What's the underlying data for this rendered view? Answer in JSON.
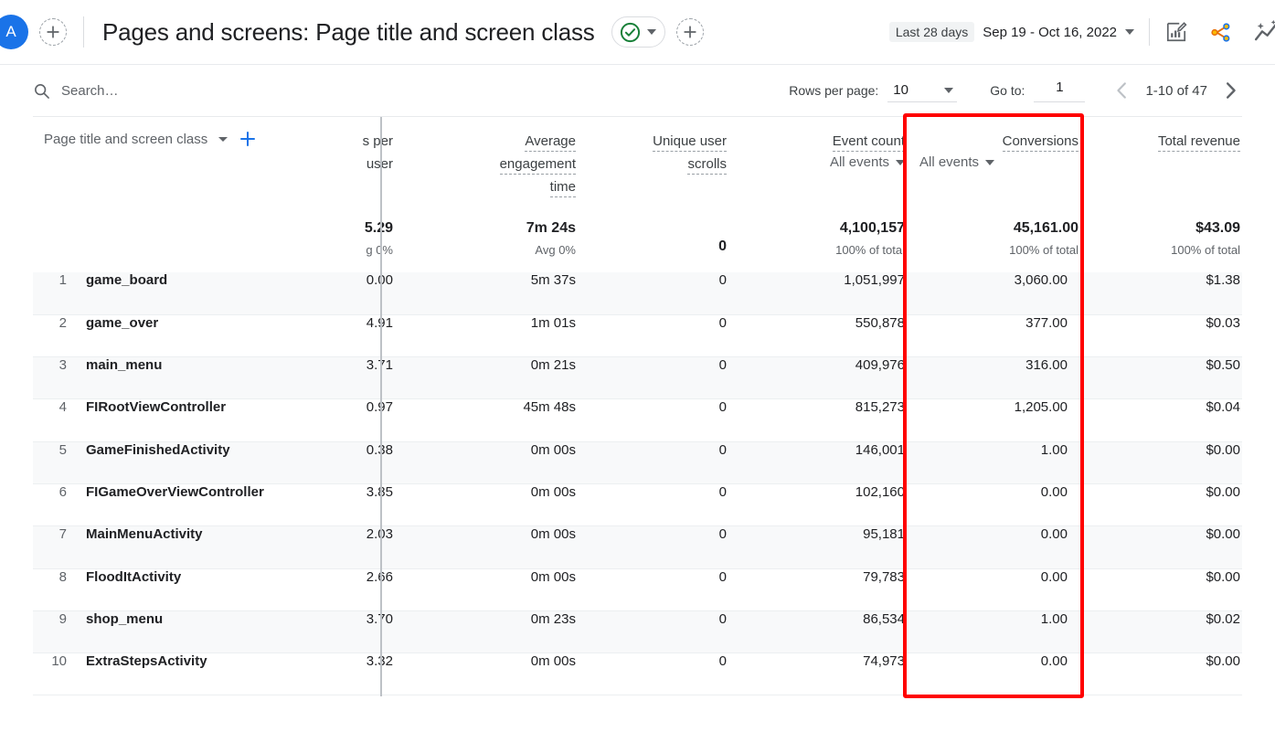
{
  "appbar": {
    "avatar_letter": "A",
    "add_comparison_label": "+",
    "title": "Pages and screens: Page title and screen class",
    "status_chip": "check-circle",
    "add_filter_label": "+",
    "date_chip": "Last 28 days",
    "date_range": "Sep 19 - Oct 16, 2022",
    "icons": [
      "edit-chart-icon",
      "share-icon",
      "insights-icon"
    ]
  },
  "toolbar": {
    "search_placeholder": "Search…",
    "rows_per_page_label": "Rows per page:",
    "rows_per_page_value": "10",
    "goto_label": "Go to:",
    "goto_value": "1",
    "range_text": "1-10 of 47"
  },
  "table": {
    "dimension_header": "Page title and screen class",
    "columns": [
      {
        "id": "clipped_per_user",
        "line1": "s per",
        "line2": "user",
        "sub": null,
        "total": "5.29",
        "total_sub": "g 0%",
        "clipped": true
      },
      {
        "id": "avg_engagement_time",
        "line1": "Average",
        "line2": "engagement",
        "line3": "time",
        "sub": null,
        "total": "7m 24s",
        "total_sub": "Avg 0%",
        "clipped": false
      },
      {
        "id": "unique_user_scrolls",
        "line1": "Unique user",
        "line2": "scrolls",
        "sub": null,
        "total": "0",
        "total_sub": "",
        "clipped": false
      },
      {
        "id": "event_count",
        "line1": "Event count",
        "sub": "All events",
        "total": "4,100,157",
        "total_sub": "100% of total",
        "clipped": false
      },
      {
        "id": "conversions",
        "line1": "Conversions",
        "sub": "All events",
        "total": "45,161.00",
        "total_sub": "100% of total",
        "clipped": false
      },
      {
        "id": "total_revenue",
        "line1": "Total revenue",
        "sub": null,
        "total": "$43.09",
        "total_sub": "100% of total",
        "clipped": false
      }
    ],
    "rows": [
      {
        "index": "1",
        "name": "game_board",
        "per_user": "0.00",
        "engagement": "5m 37s",
        "scrolls": "0",
        "events": "1,051,997",
        "conversions": "3,060.00",
        "revenue": "$1.38"
      },
      {
        "index": "2",
        "name": "game_over",
        "per_user": "4.91",
        "engagement": "1m 01s",
        "scrolls": "0",
        "events": "550,878",
        "conversions": "377.00",
        "revenue": "$0.03"
      },
      {
        "index": "3",
        "name": "main_menu",
        "per_user": "3.71",
        "engagement": "0m 21s",
        "scrolls": "0",
        "events": "409,976",
        "conversions": "316.00",
        "revenue": "$0.50"
      },
      {
        "index": "4",
        "name": "FIRootViewController",
        "per_user": "0.97",
        "engagement": "45m 48s",
        "scrolls": "0",
        "events": "815,273",
        "conversions": "1,205.00",
        "revenue": "$0.04"
      },
      {
        "index": "5",
        "name": "GameFinishedActivity",
        "per_user": "0.38",
        "engagement": "0m 00s",
        "scrolls": "0",
        "events": "146,001",
        "conversions": "1.00",
        "revenue": "$0.00"
      },
      {
        "index": "6",
        "name": "FIGameOverViewController",
        "per_user": "3.85",
        "engagement": "0m 00s",
        "scrolls": "0",
        "events": "102,160",
        "conversions": "0.00",
        "revenue": "$0.00"
      },
      {
        "index": "7",
        "name": "MainMenuActivity",
        "per_user": "2.03",
        "engagement": "0m 00s",
        "scrolls": "0",
        "events": "95,181",
        "conversions": "0.00",
        "revenue": "$0.00"
      },
      {
        "index": "8",
        "name": "FloodItActivity",
        "per_user": "2.66",
        "engagement": "0m 00s",
        "scrolls": "0",
        "events": "79,783",
        "conversions": "0.00",
        "revenue": "$0.00"
      },
      {
        "index": "9",
        "name": "shop_menu",
        "per_user": "3.70",
        "engagement": "0m 23s",
        "scrolls": "0",
        "events": "86,534",
        "conversions": "1.00",
        "revenue": "$0.02"
      },
      {
        "index": "10",
        "name": "ExtraStepsActivity",
        "per_user": "3.32",
        "engagement": "0m 00s",
        "scrolls": "0",
        "events": "74,973",
        "conversions": "0.00",
        "revenue": "$0.00"
      }
    ]
  },
  "annotation": {
    "color": "#ff0000",
    "target_column": "Conversions"
  },
  "colors": {
    "accent_blue": "#1a73e8",
    "row_alt": "#f8f9fa",
    "text_primary": "#202124",
    "text_secondary": "#5f6368",
    "annotation_red": "#ff0000"
  }
}
